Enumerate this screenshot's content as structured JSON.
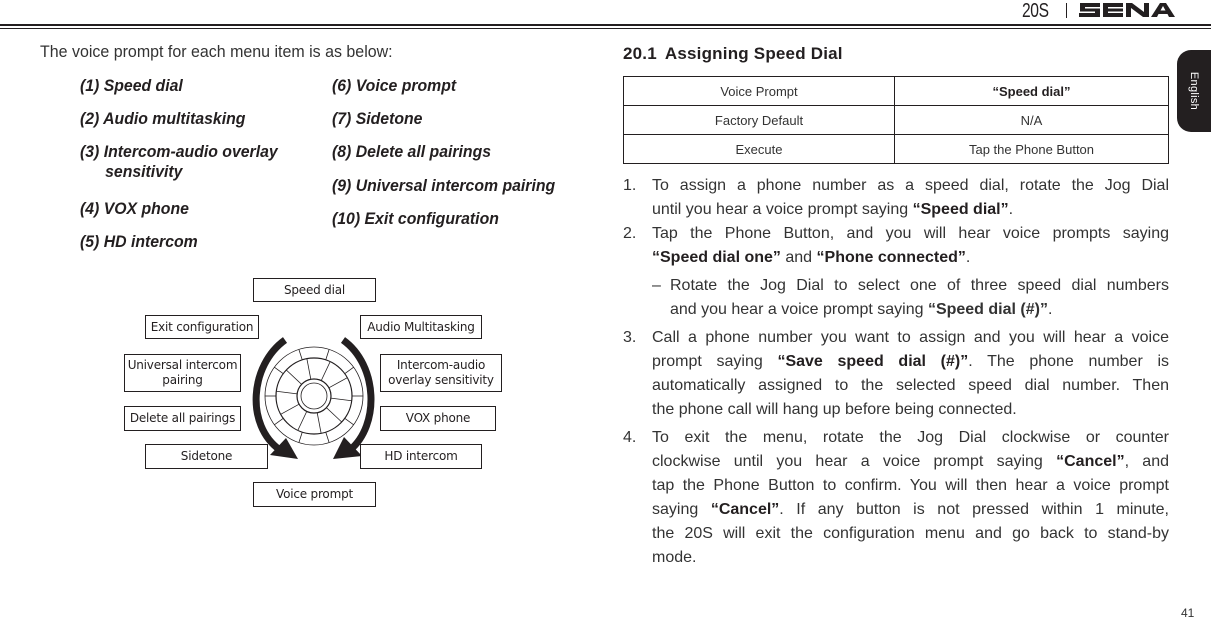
{
  "header": {
    "model": "20S",
    "brand": "SENA",
    "logo_icon": "sena-logo-icon"
  },
  "language_tab": {
    "label": "English"
  },
  "left": {
    "intro": "The voice prompt for each menu item is as below:",
    "menu_items_col1": [
      {
        "label": "(1) Speed dial"
      },
      {
        "label": "(2) Audio multitasking"
      },
      {
        "label": "(3) Intercom-audio overlay",
        "continuation": "sensitivity"
      },
      {
        "label": "(4) VOX phone"
      },
      {
        "label": "(5) HD intercom"
      }
    ],
    "menu_items_col2": [
      {
        "label": "(6) Voice prompt"
      },
      {
        "label": "(7) Sidetone"
      },
      {
        "label": "(8) Delete all pairings"
      },
      {
        "label": "(9) Universal intercom pairing"
      },
      {
        "label": "(10) Exit configuration"
      }
    ],
    "diagram": {
      "dial_icon": "jog-dial-icon",
      "left_arrow_icon": "counterclockwise-arrow-icon",
      "right_arrow_icon": "clockwise-arrow-icon",
      "boxes": {
        "top": "Speed dial",
        "right1": "Audio Multitasking",
        "right2_line1": "Intercom-audio",
        "right2_line2": "overlay sensitivity",
        "right3": "VOX phone",
        "right4": "HD intercom",
        "bottom": "Voice prompt",
        "left4": "Sidetone",
        "left3": "Delete all pairings",
        "left2_line1": "Universal intercom",
        "left2_line2": "pairing",
        "left1": "Exit configuration"
      }
    }
  },
  "right": {
    "section_number": "20.1",
    "section_title": "Assigning Speed Dial",
    "table": [
      {
        "key": "Voice Prompt",
        "value": "“Speed dial”",
        "bold": true
      },
      {
        "key": "Factory Default",
        "value": "N/A",
        "bold": false
      },
      {
        "key": "Execute",
        "value": "Tap the Phone Button",
        "bold": false
      }
    ],
    "steps": {
      "s1": {
        "num": "1.",
        "l1": "To assign a phone number as a speed dial, rotate the Jog Dial",
        "l2_pre": "until you hear a voice prompt saying ",
        "l2_bold": "“Speed dial”",
        "l2_post": "."
      },
      "s2": {
        "num": "2.",
        "l1": "Tap the Phone Button, and you will hear voice prompts saying",
        "l2_bold1": "“Speed dial one”",
        "l2_mid": " and ",
        "l2_bold2": "“Phone connected”",
        "l2_post": "."
      },
      "s2_sub": {
        "dash": "–",
        "l1": "Rotate the Jog Dial to select one of three speed dial numbers",
        "l2_pre": "and you hear a voice prompt saying ",
        "l2_bold": "“Speed dial (#)”",
        "l2_post": "."
      },
      "s3": {
        "num": "3.",
        "l1": "Call a phone number you want to assign and you will hear a voice",
        "l2_pre": "prompt saying ",
        "l2_bold": "“Save speed dial (#)”",
        "l2_post": ". The phone number is",
        "l3": "automatically assigned to the selected speed dial number. Then",
        "l4": "the phone call will hang up before being connected."
      },
      "s4": {
        "num": "4.",
        "l1": "To exit the menu, rotate the Jog Dial clockwise or counter",
        "l2_pre": "clockwise until you hear a voice prompt saying ",
        "l2_bold": "“Cancel”",
        "l2_post": ", and",
        "l3": "tap the Phone Button to confirm. You will then hear a voice prompt",
        "l4_pre": "saying ",
        "l4_bold": "“Cancel”",
        "l4_post": ". If any button is not pressed within 1 minute,",
        "l5": "the 20S will exit the configuration menu and go back to stand-by",
        "l6": "mode."
      }
    }
  },
  "footer": {
    "page_number": "41"
  }
}
